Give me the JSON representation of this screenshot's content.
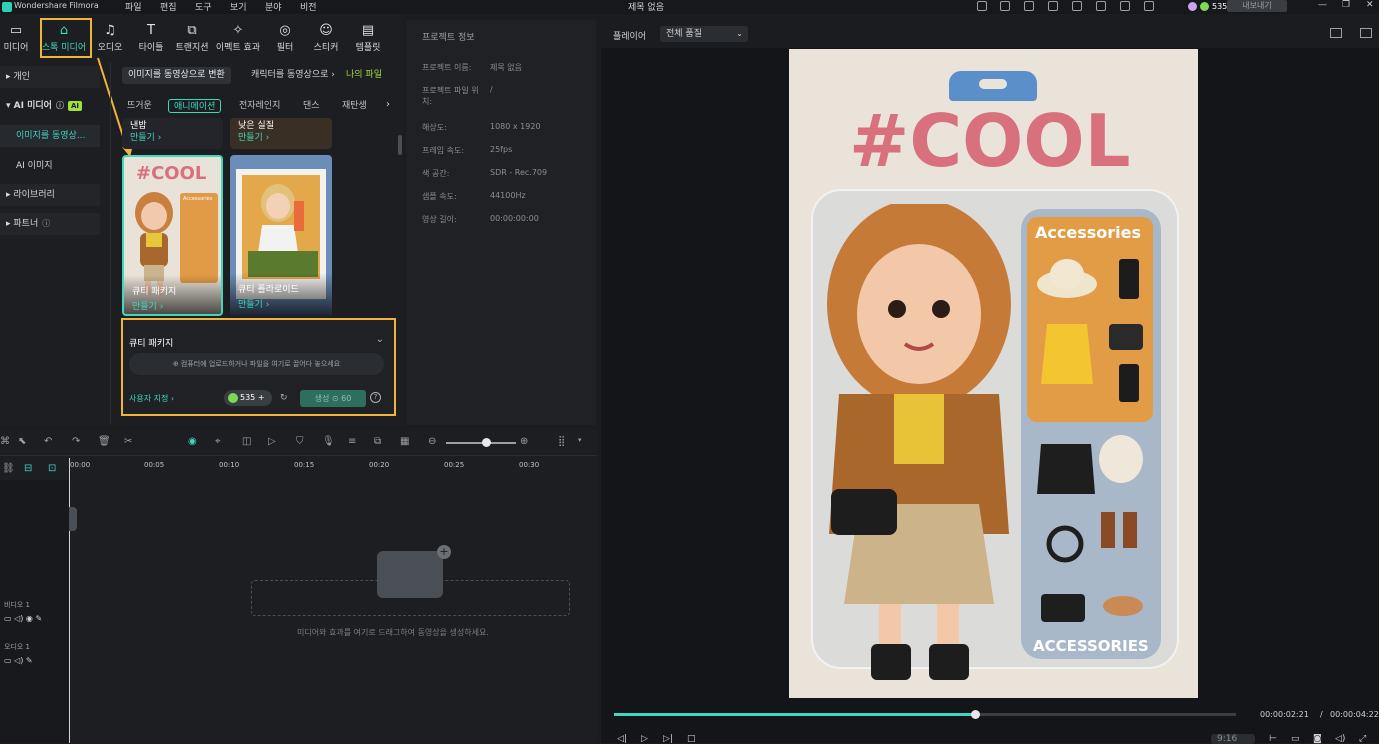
{
  "titlebar": {
    "app_name": "Wondershare Filmora",
    "menu": [
      "파일",
      "편집",
      "도구",
      "보기",
      "분야",
      "비전"
    ],
    "project_title": "제목 없음",
    "credits": "535",
    "export_label": "내보내기"
  },
  "toolbar": {
    "items": [
      {
        "label": "미디어",
        "icon": "media-icon"
      },
      {
        "label": "스톡 미디어",
        "icon": "stock-media-icon"
      },
      {
        "label": "오디오",
        "icon": "music-note-icon"
      },
      {
        "label": "타이틀",
        "icon": "title-T-icon"
      },
      {
        "label": "트랜지션",
        "icon": "transition-icon"
      },
      {
        "label": "이펙트 효과",
        "icon": "effects-icon"
      },
      {
        "label": "필터",
        "icon": "filter-icon"
      },
      {
        "label": "스티커",
        "icon": "sticker-icon"
      },
      {
        "label": "템플릿",
        "icon": "template-icon"
      }
    ]
  },
  "sidenav": {
    "personal": "개인",
    "ai_media": "AI 미디어",
    "ai_badge": "AI",
    "image_to_video": "이미지를 동영상...",
    "ai_image": "AI 이미지",
    "library": "라이브러리",
    "partner": "파트너"
  },
  "content": {
    "tabs": [
      "이미지를 동영상으로 변환",
      "캐릭터를 동영상으로 ›",
      "나의 파일"
    ],
    "categories": [
      "뜨거운",
      "애니메이션",
      "전자레인지",
      "댄스",
      "재탄생"
    ],
    "cards_top": [
      {
        "title": "낸밥",
        "make": "만들기 ›"
      },
      {
        "title": "낮은 실질",
        "make": "만들기 ›"
      }
    ],
    "cards": [
      {
        "title": "큐티 패키지",
        "make": "만들기 ›"
      },
      {
        "title": "큐티 폴라로이드",
        "make": "만들기 ›"
      }
    ],
    "card_image_text": {
      "cool": "#COOL",
      "accessories": "Accessories"
    }
  },
  "panel": {
    "title": "큐티 패키지",
    "upload_hint": "⊕ 컴퓨터에 업로드하거나 파일을 여기로 끌어다 놓으세요",
    "custom": "사용자 지정 ›",
    "credits": "535 +",
    "generate": "생성 ⊙ 60",
    "help": "?"
  },
  "project_info": {
    "header": "프로젝트 정보",
    "rows": [
      {
        "k": "프로젝트 이름:",
        "v": "제목 없음"
      },
      {
        "k": "프로젝트 파일 위치:",
        "v": "/"
      },
      {
        "k": "해상도:",
        "v": "1080 x 1920"
      },
      {
        "k": "프레임 속도:",
        "v": "25fps"
      },
      {
        "k": "색 공간:",
        "v": "SDR - Rec.709"
      },
      {
        "k": "샘플 속도:",
        "v": "44100Hz"
      },
      {
        "k": "영상 길이:",
        "v": "00:00:00:00"
      }
    ]
  },
  "player": {
    "label": "플레이어",
    "quality": "전체 품질",
    "current_time": "00:00:02:21",
    "separator": "/",
    "total_time": "00:00:04:22",
    "progress": 0.58,
    "preview_cool": "#COOL",
    "preview_accessories": "Accessories",
    "preview_accessories_caps": "ACCESSORIES",
    "speed": "9:16"
  },
  "timeline": {
    "ruler": [
      "00:00",
      "00:05",
      "00:10",
      "00:15",
      "00:20",
      "00:25",
      "00:30"
    ],
    "tracks": [
      {
        "name": "비디오 1"
      },
      {
        "name": "오디오 1"
      }
    ],
    "drop_hint": "미디어와 효과를 여기로 드래그하여 동영상을 생성하세요."
  },
  "colors": {
    "accent": "#40d7bd",
    "highlight": "#f0b43a",
    "background": "#1a1c20"
  }
}
